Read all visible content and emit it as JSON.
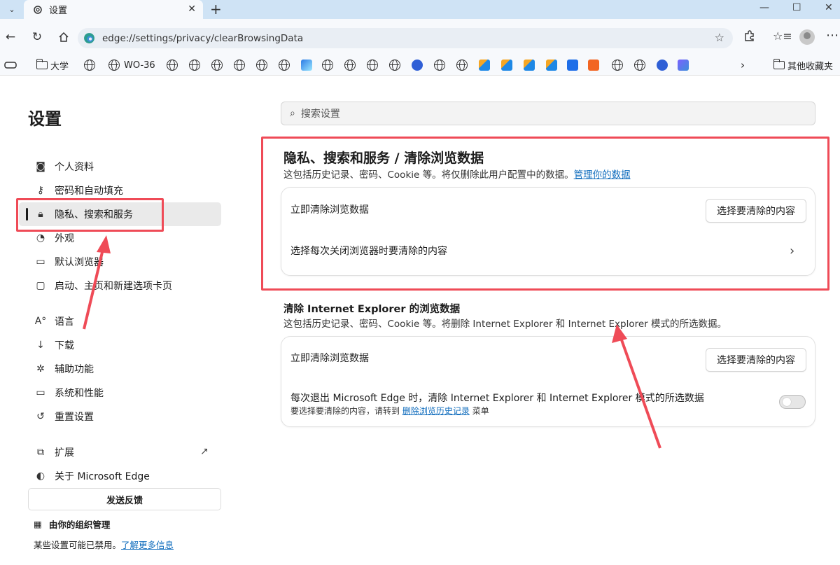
{
  "browser": {
    "tab_title": "设置",
    "url": "edge://settings/privacy/clearBrowsingData"
  },
  "favorites": {
    "items": [
      "大学",
      "WO-36"
    ],
    "other": "其他收藏夹"
  },
  "sidebar": {
    "title": "设置",
    "items": [
      {
        "label": "个人资料",
        "icon": "profile-icon"
      },
      {
        "label": "密码和自动填充",
        "icon": "key-icon"
      },
      {
        "label": "隐私、搜索和服务",
        "icon": "lock-icon"
      },
      {
        "label": "外观",
        "icon": "palette-icon"
      },
      {
        "label": "默认浏览器",
        "icon": "browser-icon"
      },
      {
        "label": "启动、主页和新建选项卡页",
        "icon": "home-icon"
      },
      {
        "label": "语言",
        "icon": "language-icon"
      },
      {
        "label": "下载",
        "icon": "download-icon"
      },
      {
        "label": "辅助功能",
        "icon": "accessibility-icon"
      },
      {
        "label": "系统和性能",
        "icon": "laptop-icon"
      },
      {
        "label": "重置设置",
        "icon": "reset-icon"
      },
      {
        "label": "扩展",
        "icon": "extension-icon"
      },
      {
        "label": "关于 Microsoft Edge",
        "icon": "edge-icon"
      }
    ],
    "feedback": "发送反馈",
    "managed": "由你的组织管理",
    "disabled_text": "某些设置可能已禁用。",
    "learn_more": "了解更多信息"
  },
  "main": {
    "search_placeholder": "搜索设置",
    "title": "隐私、搜索和服务 / 清除浏览数据",
    "desc": "这包括历史记录、密码、Cookie 等。将仅删除此用户配置中的数据。",
    "manage_link": "管理你的数据",
    "card1": {
      "row1": "立即清除浏览数据",
      "button": "选择要清除的内容",
      "row2": "选择每次关闭浏览器时要清除的内容"
    },
    "ie_title": "清除 Internet Explorer 的浏览数据",
    "ie_desc": "这包括历史记录、密码、Cookie 等。将删除 Internet Explorer 和 Internet Explorer 模式的所选数据。",
    "card2": {
      "row1": "立即清除浏览数据",
      "button": "选择要清除的内容",
      "row2": "每次退出 Microsoft Edge 时，清除 Internet Explorer 和 Internet Explorer 模式的所选数据",
      "sub_prefix": "要选择要清除的内容，请转到",
      "sub_link": "删除浏览历史记录",
      "sub_suffix": "菜单",
      "toggle_on": false
    }
  },
  "colors": {
    "accent": "#0f6cbd",
    "highlight": "#ef4b57"
  }
}
